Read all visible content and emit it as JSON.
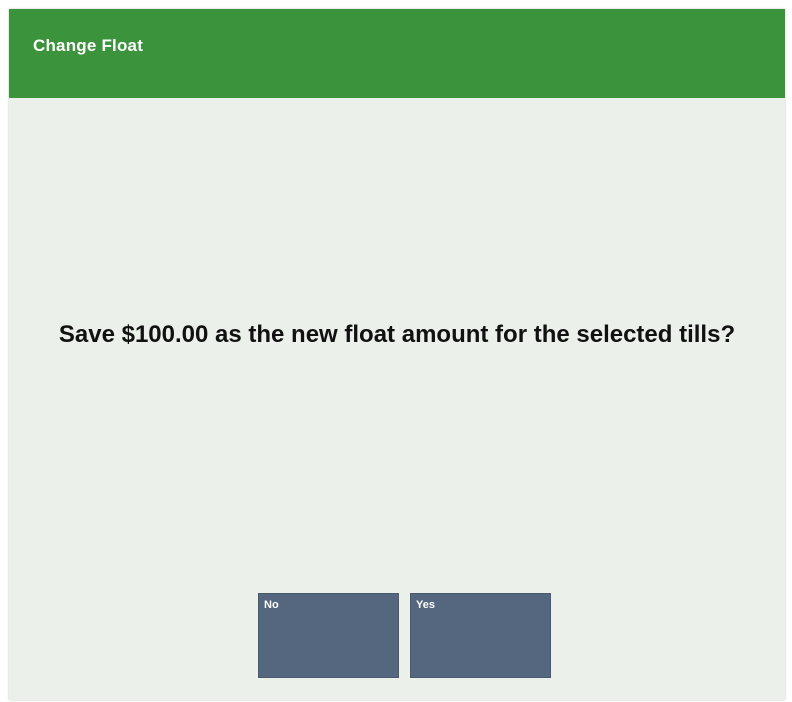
{
  "dialog": {
    "title": "Change Float",
    "message": "Save $100.00 as the new float amount for the selected tills?",
    "buttons": {
      "no_label": "No",
      "yes_label": "Yes"
    }
  },
  "colors": {
    "title_bar": "#3b943c",
    "background": "#ebf0ea",
    "button": "#55677e",
    "button_text": "#ffffff",
    "message_text": "#111111"
  }
}
